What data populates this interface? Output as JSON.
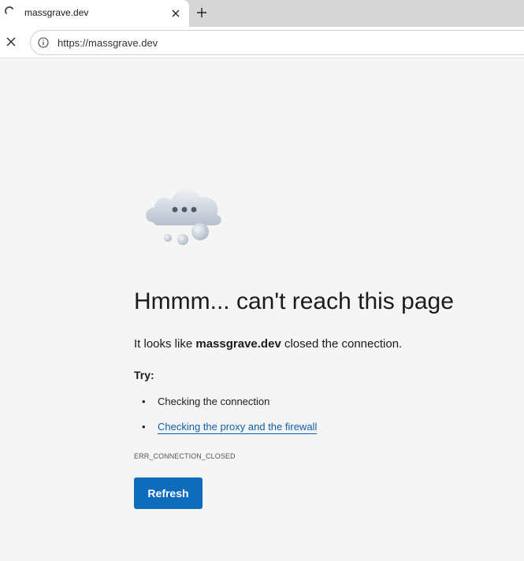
{
  "tab": {
    "title": "massgrave.dev",
    "spinner_icon": "loading-spinner-icon",
    "close_icon": "close-icon"
  },
  "new_tab": {
    "icon": "plus-icon"
  },
  "toolbar": {
    "stop_icon": "close-icon",
    "info_icon": "info-icon",
    "url": "https://massgrave.dev"
  },
  "error": {
    "illustration_icon": "cloud-icon",
    "heading": "Hmmm... can't reach this page",
    "desc_prefix": "It looks like ",
    "desc_host": "massgrave.dev",
    "desc_suffix": " closed the connection.",
    "try_label": "Try:",
    "suggestions": [
      {
        "text": "Checking the connection"
      },
      {
        "text": "Checking the proxy and the firewall"
      }
    ],
    "code": "ERR_CONNECTION_CLOSED",
    "refresh_label": "Refresh"
  },
  "colors": {
    "accent": "#0f6cbd",
    "link": "#0f5ea8",
    "page_bg": "#f5f5f5",
    "tabstrip_bg": "#d6d6d6"
  }
}
